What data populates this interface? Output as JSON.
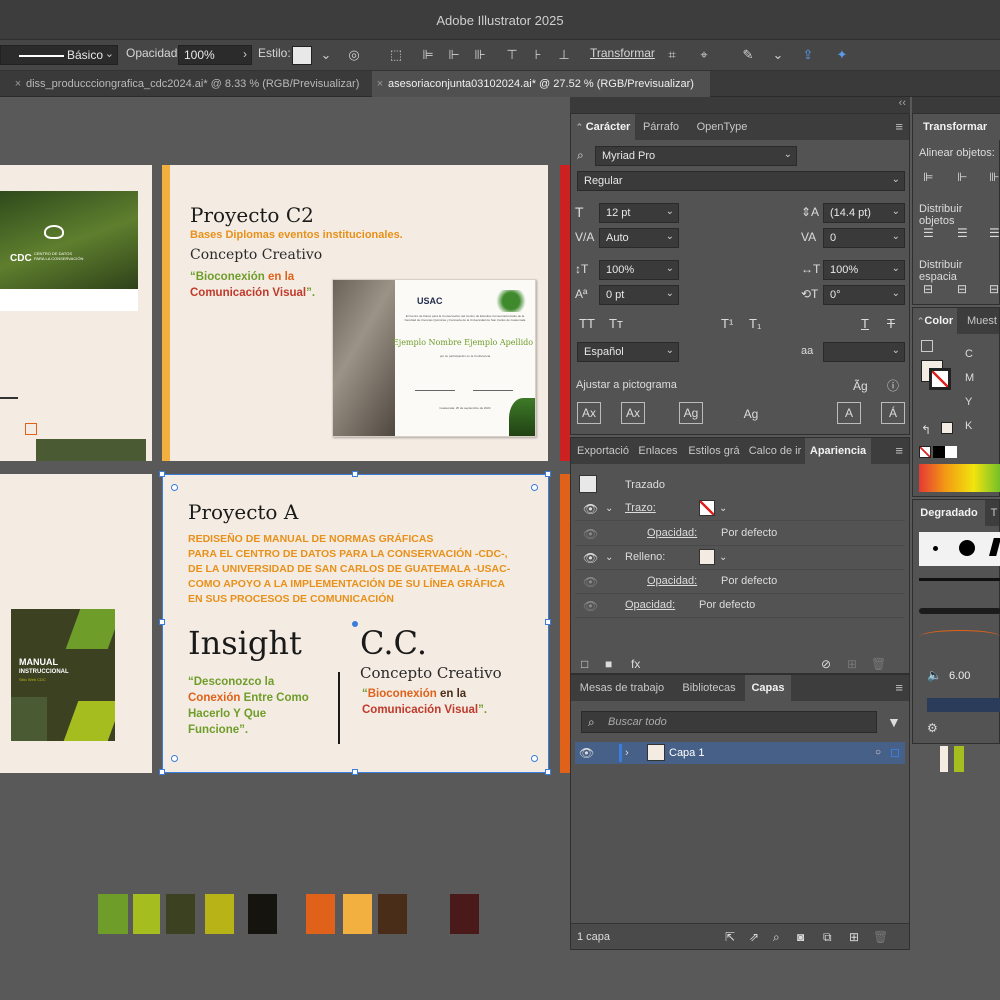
{
  "app": {
    "title": "Adobe Illustrator 2025"
  },
  "control_bar": {
    "stroke_profile": "Básico",
    "opacity_label": "Opacidad:",
    "opacity_value": "100%",
    "style_label": "Estilo:",
    "transform_label": "Transformar"
  },
  "document_tabs": [
    {
      "label": "diss_produccciongrafica_cdc2024.ai* @ 8.33 % (RGB/Previsualizar)"
    },
    {
      "label": "asesoriaconjunta03102024.ai* @ 27.52 % (RGB/Previsualizar)"
    }
  ],
  "artboards": {
    "top_left": {
      "cover_title": "CDC",
      "cover_subtitle_1": "CENTRO DE DATOS",
      "cover_subtitle_2": "PARA LA CONSERVACIÓN",
      "small_logo": "USAC"
    },
    "proyecto_c2": {
      "title": "Proyecto C2",
      "subtitle": "Bases Diplomas eventos institucionales.",
      "concept": "Concepto Creativo",
      "quote_open": "“",
      "quote_word1": "Bioconexión",
      "quote_word2": " en la",
      "quote_line2": "Comunicación Visual",
      "quote_close": "”.",
      "diploma": {
        "logo": "USAC",
        "name": "Ejemplo Nombre Ejemplo Apellido",
        "lead_text": "El Centro de Datos para la Conservación del Centro de Estudios Conservacionistas de la Facultad de Ciencias Químicas y Farmacia de la Universidad de San Carlos de Guatemala",
        "participation": "por su participación en la Conferencia",
        "footer": "Guatemala, 25 de septiembre de 2024"
      }
    },
    "proyecto_a": {
      "title": "Proyecto A",
      "description": [
        "REDISEÑO DE MANUAL DE NORMAS GRÁFICAS",
        "PARA EL CENTRO DE DATOS PARA LA CONSERVACIÓN -CDC-,",
        "DE LA UNIVERSIDAD DE SAN CARLOS DE GUATEMALA -USAC-",
        "COMO APOYO A LA IMPLEMENTACIÓN DE SU LÍNEA GRÁFICA",
        "EN SUS PROCESOS DE COMUNICACIÓN"
      ],
      "insight_title": "Insight",
      "insight_l1": "“Desconozco la",
      "insight_l2a": "Conexión",
      "insight_l2b": " Entre Como",
      "insight_l3": "Hacerlo Y Que",
      "insight_l4": "Funcione”.",
      "cc_title": "C.C.",
      "cc_concept": "Concepto Creativo",
      "cc_q_open": "“",
      "cc_q_word1": "Bioconexión",
      "cc_q_word2": " en la",
      "cc_q_line2": "Comunicación Visual",
      "cc_q_close": "”.",
      "manual_title": "MANUAL",
      "manual_sub": "INSTRUCCIONAL",
      "manual_sub2": "Sitio Web CDC"
    }
  },
  "palette": [
    "#6f9d2a",
    "#a6bd20",
    "#3c4221",
    "#b8b417",
    "#15140e",
    "#e0611a",
    "#f1b040",
    "#4a2d18",
    "#4a1a1a"
  ],
  "character_panel": {
    "tabs": [
      "Carácter",
      "Párrafo",
      "OpenType"
    ],
    "font_family": "Myriad Pro",
    "font_style": "Regular",
    "font_size": "12 pt",
    "leading": "(14.4 pt)",
    "kerning": "Auto",
    "tracking": "0",
    "vscale": "100%",
    "hscale": "100%",
    "baseline": "0 pt",
    "rotation": "0°",
    "language": "Español",
    "snap_label": "Ajustar a pictograma",
    "aa_label": "aa"
  },
  "appearance_panel": {
    "tabs": [
      "Exportació",
      "Enlaces",
      "Estilos grá",
      "Calco de ir",
      "Apariencia"
    ],
    "header": "Trazado",
    "stroke_label": "Trazo:",
    "opacity_label": "Opacidad:",
    "opacity_value": "Por defecto",
    "fill_label": "Relleno:",
    "opacity2_label": "Opacidad:",
    "opacity2_value": "Por defecto",
    "opacity3_label": "Opacidad:",
    "opacity3_value": "Por defecto"
  },
  "layers_panel": {
    "tabs": [
      "Mesas de trabajo",
      "Bibliotecas",
      "Capas"
    ],
    "search_placeholder": "Buscar todo",
    "layer_name": "Capa 1",
    "footer_count": "1 capa"
  },
  "right_panels": {
    "transform_tab": "Transformar",
    "align_objects": "Alinear objetos:",
    "distribute_objects": "Distribuir objetos",
    "distribute_spacing": "Distribuir espacia",
    "color_tab": "Color",
    "swatches_tab": "Muest",
    "channels": [
      "C",
      "M",
      "Y",
      "K"
    ],
    "gradient_tab": "Degradado",
    "brush_size": "6.00"
  }
}
